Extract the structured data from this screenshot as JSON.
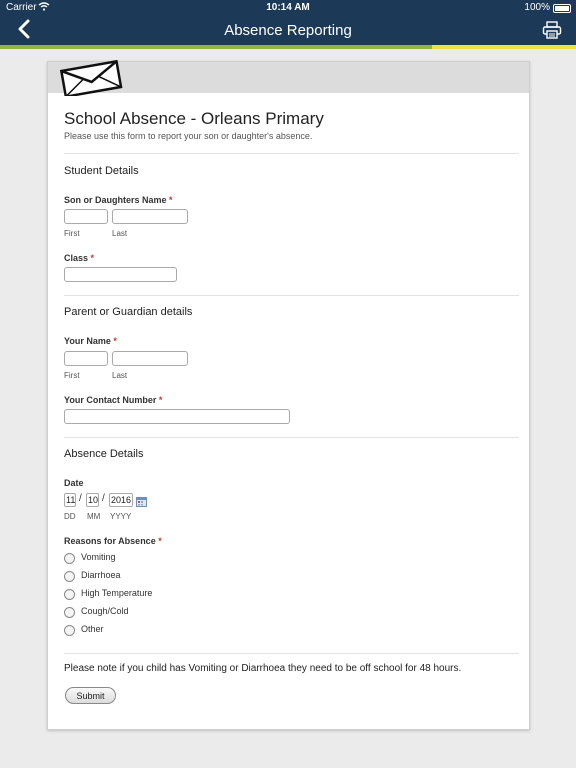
{
  "status_bar": {
    "carrier": "Carrier",
    "time": "10:14 AM",
    "battery": "100%"
  },
  "nav": {
    "title": "Absence Reporting",
    "back_icon": "chevron-left-icon",
    "print_icon": "printer-icon"
  },
  "colors": {
    "nav_bg": "#1c3a57",
    "accent_green": "#8fb542",
    "accent_yellow": "#f0e14a"
  },
  "form": {
    "title": "School Absence - Orleans Primary",
    "description": "Please use this form to report your son or daughter's absence.",
    "student": {
      "section_title": "Student Details",
      "name_label": "Son or Daughters Name",
      "first_label": "First",
      "last_label": "Last",
      "class_label": "Class"
    },
    "parent": {
      "section_title": "Parent or Guardian details",
      "name_label": "Your Name",
      "first_label": "First",
      "last_label": "Last",
      "contact_label": "Your Contact Number"
    },
    "absence": {
      "section_title": "Absence Details",
      "date_label": "Date",
      "day": "11",
      "month": "10",
      "year": "2016",
      "dd_label": "DD",
      "mm_label": "MM",
      "yyyy_label": "YYYY",
      "reasons_label": "Reasons for Absence",
      "reasons": [
        "Vomiting",
        "Diarrhoea",
        "High Temperature",
        "Cough/Cold",
        "Other"
      ]
    },
    "required_marker": "*",
    "date_separator": "/",
    "note": "Please note if you child has Vomiting or Diarrhoea they need to be off school for 48 hours.",
    "submit_label": "Submit"
  }
}
